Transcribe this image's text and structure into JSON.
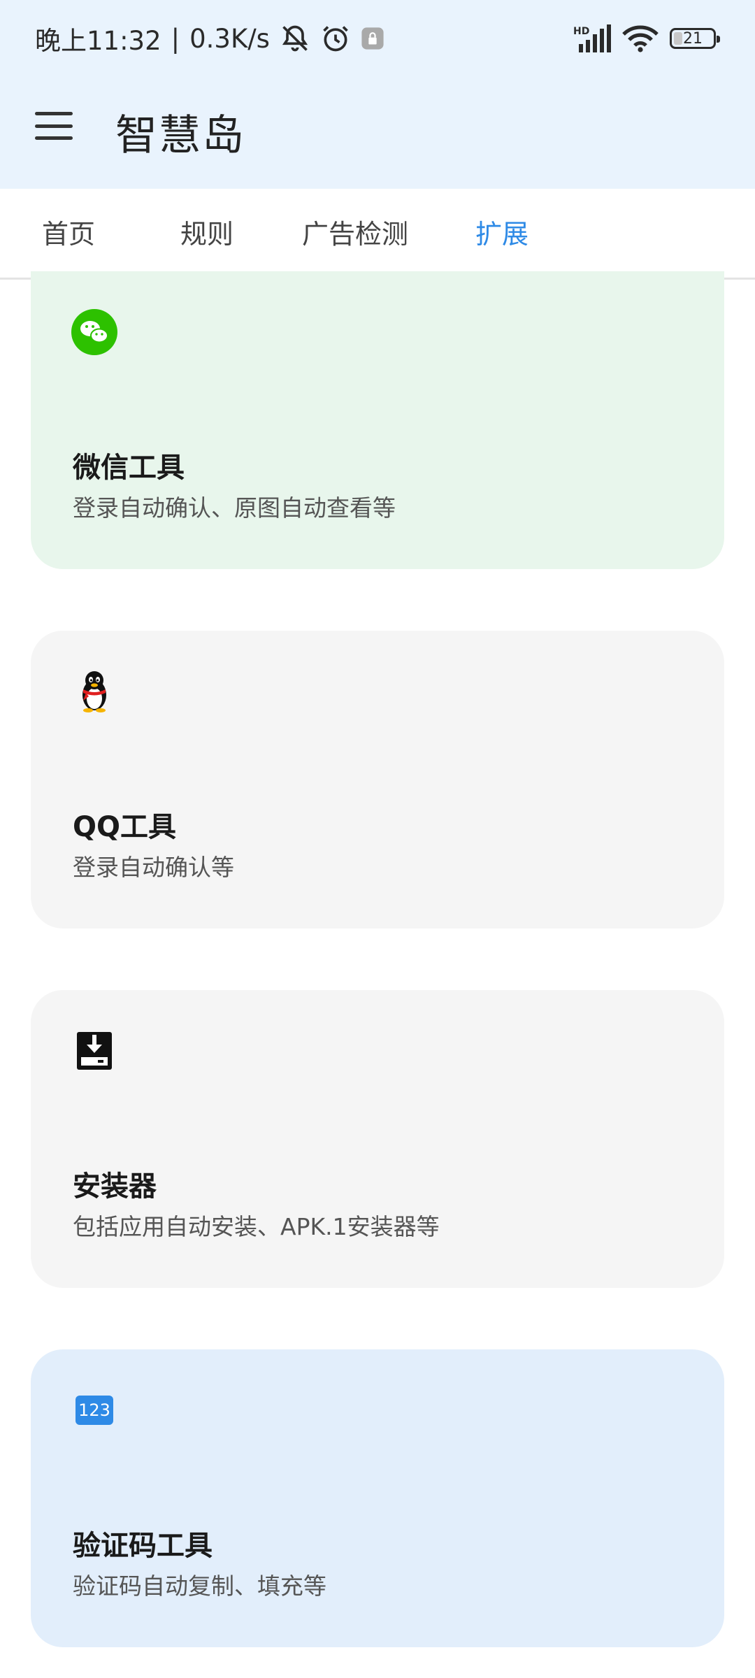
{
  "status_bar": {
    "time": "晚上11:32",
    "separator": "|",
    "speed": "0.3K/s",
    "battery": "21",
    "icons": [
      "bell-off-icon",
      "alarm-icon",
      "lock-badge-icon",
      "hd-signal-icon",
      "wifi-icon"
    ]
  },
  "app_bar": {
    "menu_icon": "menu-icon",
    "title": "智慧岛"
  },
  "tabs": [
    {
      "label": "首页",
      "active": false
    },
    {
      "label": "规则",
      "active": false
    },
    {
      "label": "广告检测",
      "active": false
    },
    {
      "label": "扩展",
      "active": true
    }
  ],
  "colors": {
    "accent": "#2e8ae6",
    "wechat_card": "#e8f6ec",
    "neutral_card": "#f5f5f5",
    "captcha_card": "#e2eefb"
  },
  "cards": [
    {
      "icon": "wechat-icon",
      "title": "微信工具",
      "desc": "登录自动确认、原图自动查看等"
    },
    {
      "icon": "qq-penguin-icon",
      "title": "QQ工具",
      "desc": "登录自动确认等"
    },
    {
      "icon": "download-box-icon",
      "title": "安装器",
      "desc": "包括应用自动安装、APK.1安装器等"
    },
    {
      "icon": "number-123-icon",
      "title": "验证码工具",
      "desc": "验证码自动复制、填充等",
      "icon_text": "123"
    }
  ]
}
